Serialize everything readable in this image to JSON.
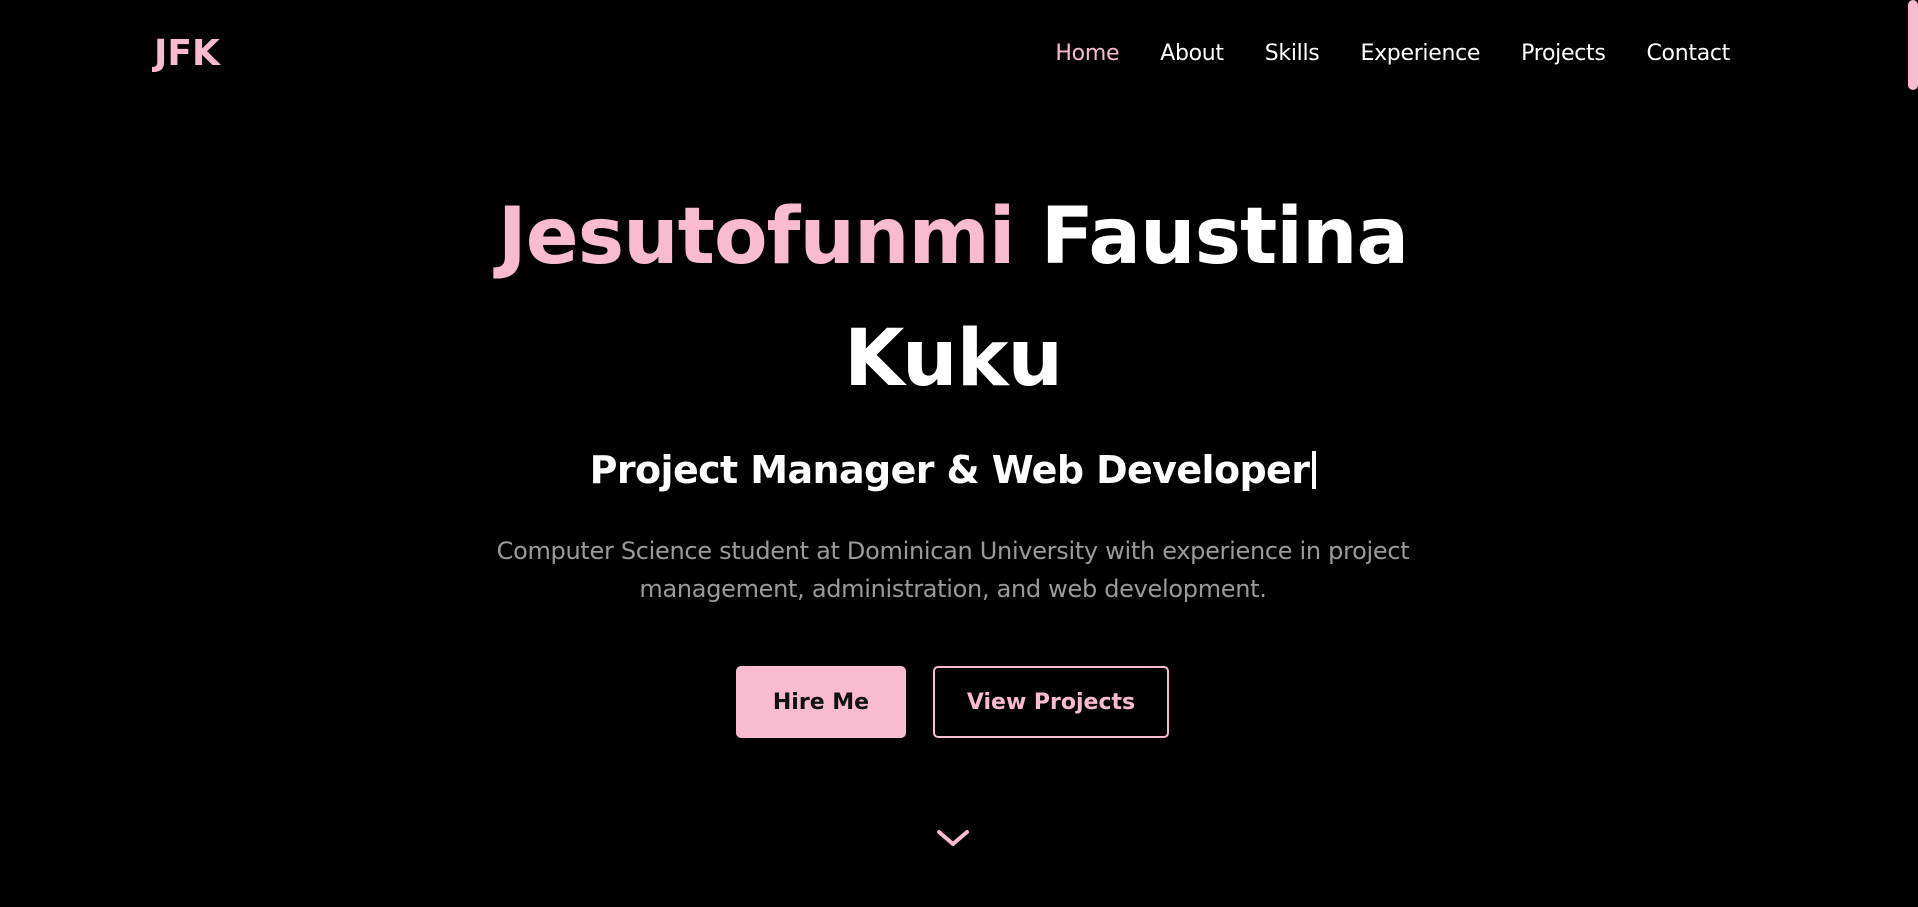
{
  "header": {
    "logo": "JFK",
    "nav": [
      {
        "label": "Home",
        "active": true
      },
      {
        "label": "About",
        "active": false
      },
      {
        "label": "Skills",
        "active": false
      },
      {
        "label": "Experience",
        "active": false
      },
      {
        "label": "Projects",
        "active": false
      },
      {
        "label": "Contact",
        "active": false
      }
    ]
  },
  "hero": {
    "first_name": "Jesutofunmi",
    "middle_name": "Faustina",
    "last_name": "Kuku",
    "subtitle": "Project Manager & Web Developer",
    "description": "Computer Science student at Dominican University with experience in project management, administration, and web development.",
    "primary_button": "Hire Me",
    "secondary_button": "View Projects"
  },
  "icons": {
    "scroll_down": "chevron-down-icon"
  },
  "colors": {
    "background": "#000000",
    "accent": "#f8bbd0",
    "text": "#ffffff",
    "muted": "#9a9a9a"
  }
}
